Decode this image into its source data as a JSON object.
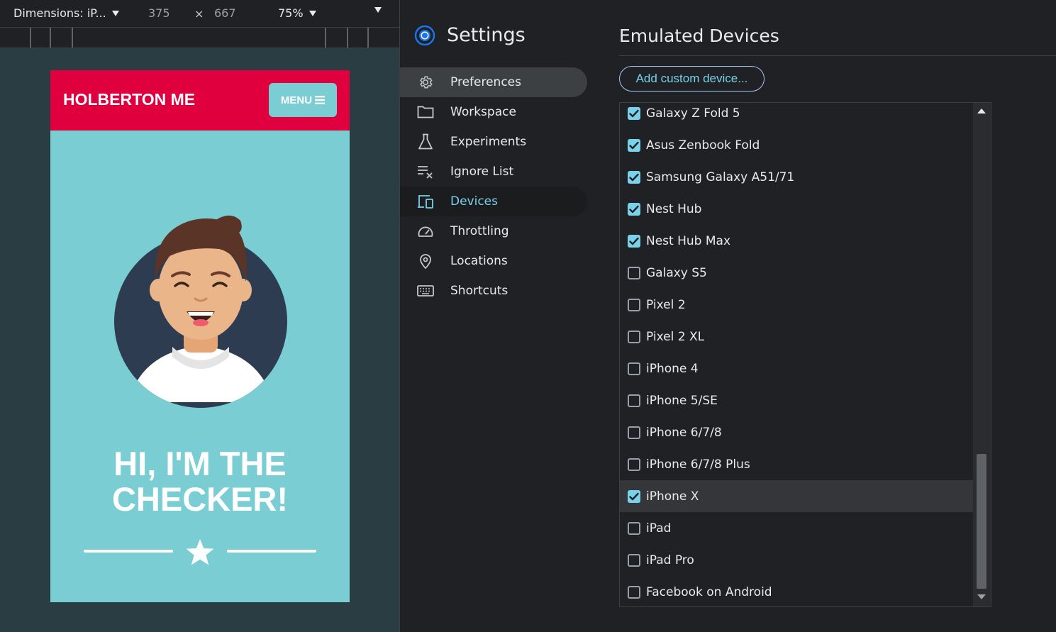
{
  "toolbar": {
    "dimensions_label": "Dimensions: iP...",
    "width": "375",
    "times": "×",
    "height": "667",
    "zoom": "75%"
  },
  "site": {
    "brand": "HOLBERTON ME",
    "menu_label": "MENU",
    "hero_line1": "HI, I'M THE",
    "hero_line2": "CHECKER!",
    "colors": {
      "header": "#e1003e",
      "background": "#79cdd3"
    }
  },
  "settings": {
    "title": "Settings",
    "nav": [
      {
        "label": "Preferences",
        "icon": "gear-icon"
      },
      {
        "label": "Workspace",
        "icon": "folder-icon"
      },
      {
        "label": "Experiments",
        "icon": "flask-icon"
      },
      {
        "label": "Ignore List",
        "icon": "ignore-list-icon"
      },
      {
        "label": "Devices",
        "icon": "devices-icon"
      },
      {
        "label": "Throttling",
        "icon": "speedometer-icon"
      },
      {
        "label": "Locations",
        "icon": "location-pin-icon"
      },
      {
        "label": "Shortcuts",
        "icon": "keyboard-icon"
      }
    ],
    "active_nav": "Devices",
    "hover_nav": "Preferences"
  },
  "emulated": {
    "title": "Emulated Devices",
    "add_button": "Add custom device...",
    "devices": [
      {
        "name": "Galaxy Z Fold 5",
        "checked": true
      },
      {
        "name": "Asus Zenbook Fold",
        "checked": true
      },
      {
        "name": "Samsung Galaxy A51/71",
        "checked": true
      },
      {
        "name": "Nest Hub",
        "checked": true
      },
      {
        "name": "Nest Hub Max",
        "checked": true
      },
      {
        "name": "Galaxy S5",
        "checked": false
      },
      {
        "name": "Pixel 2",
        "checked": false
      },
      {
        "name": "Pixel 2 XL",
        "checked": false
      },
      {
        "name": "iPhone 4",
        "checked": false
      },
      {
        "name": "iPhone 5/SE",
        "checked": false
      },
      {
        "name": "iPhone 6/7/8",
        "checked": false
      },
      {
        "name": "iPhone 6/7/8 Plus",
        "checked": false
      },
      {
        "name": "iPhone X",
        "checked": true,
        "highlighted": true
      },
      {
        "name": "iPad",
        "checked": false
      },
      {
        "name": "iPad Pro",
        "checked": false
      },
      {
        "name": "Facebook on Android",
        "checked": false
      }
    ]
  }
}
